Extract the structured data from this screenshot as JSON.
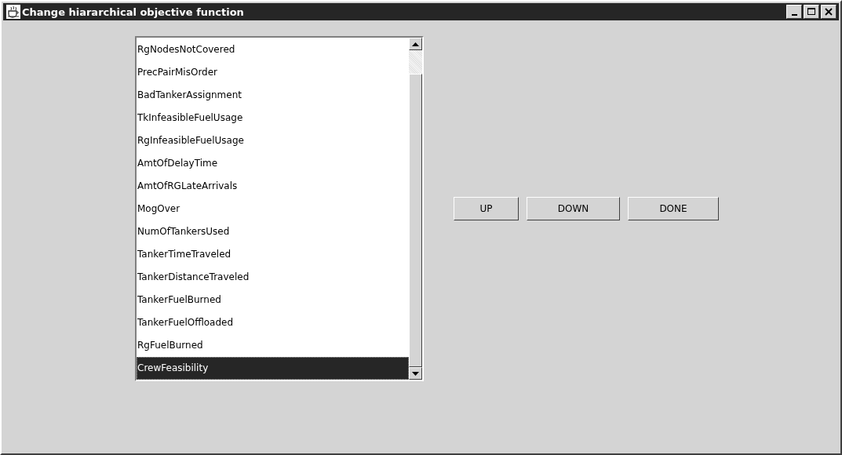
{
  "window": {
    "title": "Change hiararchical objective function"
  },
  "list": {
    "items": [
      {
        "label": "RgNodesNotCovered",
        "selected": false
      },
      {
        "label": "PrecPairMisOrder",
        "selected": false
      },
      {
        "label": "BadTankerAssignment",
        "selected": false
      },
      {
        "label": "TkInfeasibleFuelUsage",
        "selected": false
      },
      {
        "label": "RgInfeasibleFuelUsage",
        "selected": false
      },
      {
        "label": "AmtOfDelayTime",
        "selected": false
      },
      {
        "label": "AmtOfRGLateArrivals",
        "selected": false
      },
      {
        "label": "MogOver",
        "selected": false
      },
      {
        "label": "NumOfTankersUsed",
        "selected": false
      },
      {
        "label": "TankerTimeTraveled",
        "selected": false
      },
      {
        "label": "TankerDistanceTraveled",
        "selected": false
      },
      {
        "label": "TankerFuelBurned",
        "selected": false
      },
      {
        "label": "TankerFuelOffloaded",
        "selected": false
      },
      {
        "label": "RgFuelBurned",
        "selected": false
      },
      {
        "label": "CrewFeasibility",
        "selected": true
      }
    ]
  },
  "buttons": [
    "UP",
    "DOWN",
    "DONE"
  ]
}
